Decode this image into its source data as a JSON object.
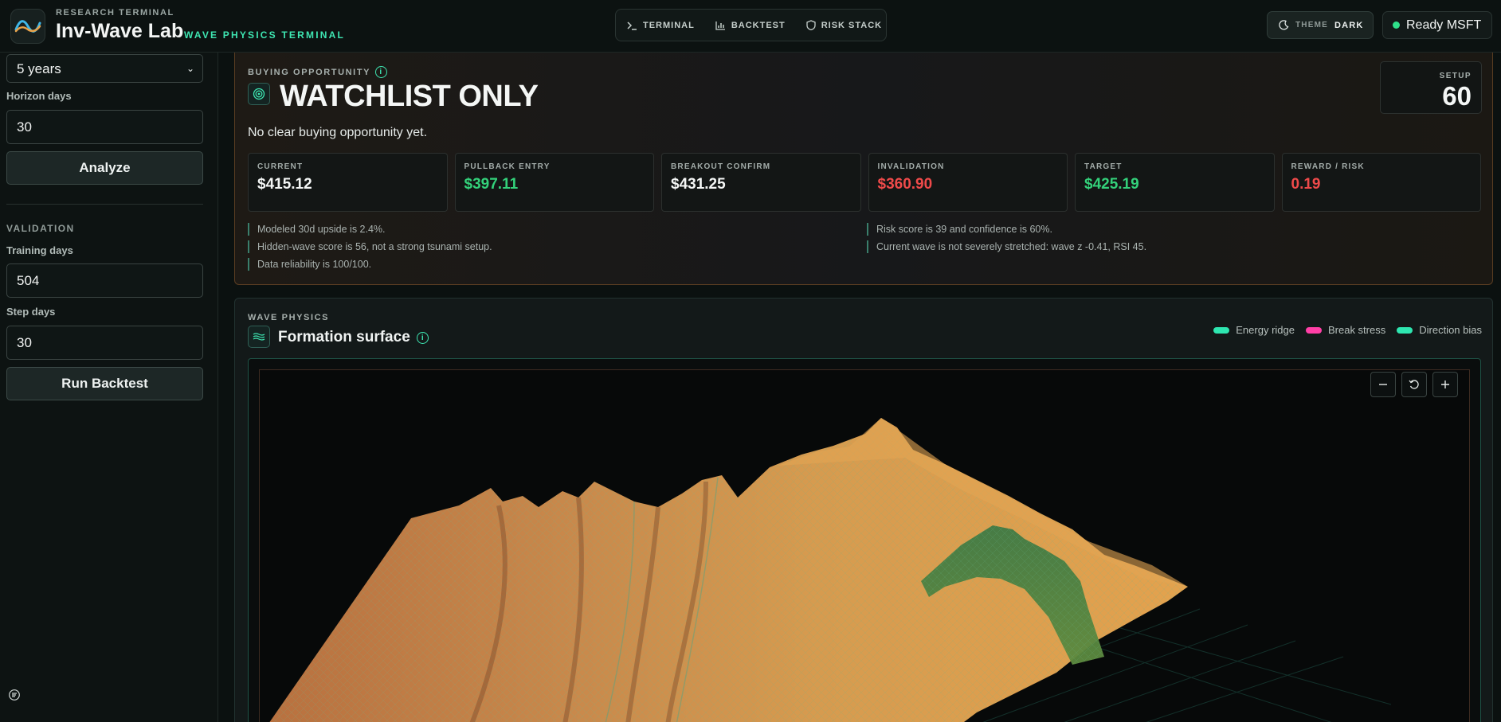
{
  "header": {
    "kicker": "RESEARCH TERMINAL",
    "title": "Inv-Wave Lab",
    "subtitle": "WAVE PHYSICS TERMINAL",
    "nav": [
      {
        "label": "TERMINAL",
        "icon": "terminal-icon"
      },
      {
        "label": "BACKTEST",
        "icon": "bar-chart-icon"
      },
      {
        "label": "RISK STACK",
        "icon": "shield-icon"
      }
    ],
    "theme_label": "THEME",
    "theme_value": "DARK",
    "status": "Ready MSFT",
    "status_color": "#2fe08a"
  },
  "sidebar": {
    "period": "5 years",
    "horizon_label": "Horizon days",
    "horizon_value": "30",
    "analyze_label": "Analyze",
    "validation_label": "VALIDATION",
    "training_label": "Training days",
    "training_value": "504",
    "step_label": "Step days",
    "step_value": "30",
    "backtest_label": "Run Backtest"
  },
  "opportunity": {
    "kicker": "BUYING OPPORTUNITY",
    "title": "WATCHLIST ONLY",
    "description": "No clear buying opportunity yet.",
    "setup_label": "SETUP",
    "setup_value": "60",
    "metrics": [
      {
        "label": "CURRENT",
        "value": "$415.12",
        "color": "#f4f6f5"
      },
      {
        "label": "PULLBACK ENTRY",
        "value": "$397.11",
        "color": "#33d17a"
      },
      {
        "label": "BREAKOUT CONFIRM",
        "value": "$431.25",
        "color": "#f4f6f5"
      },
      {
        "label": "INVALIDATION",
        "value": "$360.90",
        "color": "#ef4a4a"
      },
      {
        "label": "TARGET",
        "value": "$425.19",
        "color": "#33d17a"
      },
      {
        "label": "REWARD / RISK",
        "value": "0.19",
        "color": "#ef4a4a"
      }
    ],
    "notes_left": [
      "Modeled 30d upside is 2.4%.",
      "Hidden-wave score is 56, not a strong tsunami setup.",
      "Data reliability is 100/100."
    ],
    "notes_right": [
      "Risk score is 39 and confidence is 60%.",
      "Current wave is not severely stretched: wave z -0.41, RSI 45."
    ]
  },
  "wave": {
    "kicker": "WAVE PHYSICS",
    "title": "Formation surface",
    "legend": [
      {
        "label": "Energy ridge",
        "color": "#2ee6b0"
      },
      {
        "label": "Break stress",
        "color": "#ff3fa6"
      },
      {
        "label": "Direction bias",
        "color": "#2ee6b0"
      }
    ]
  }
}
